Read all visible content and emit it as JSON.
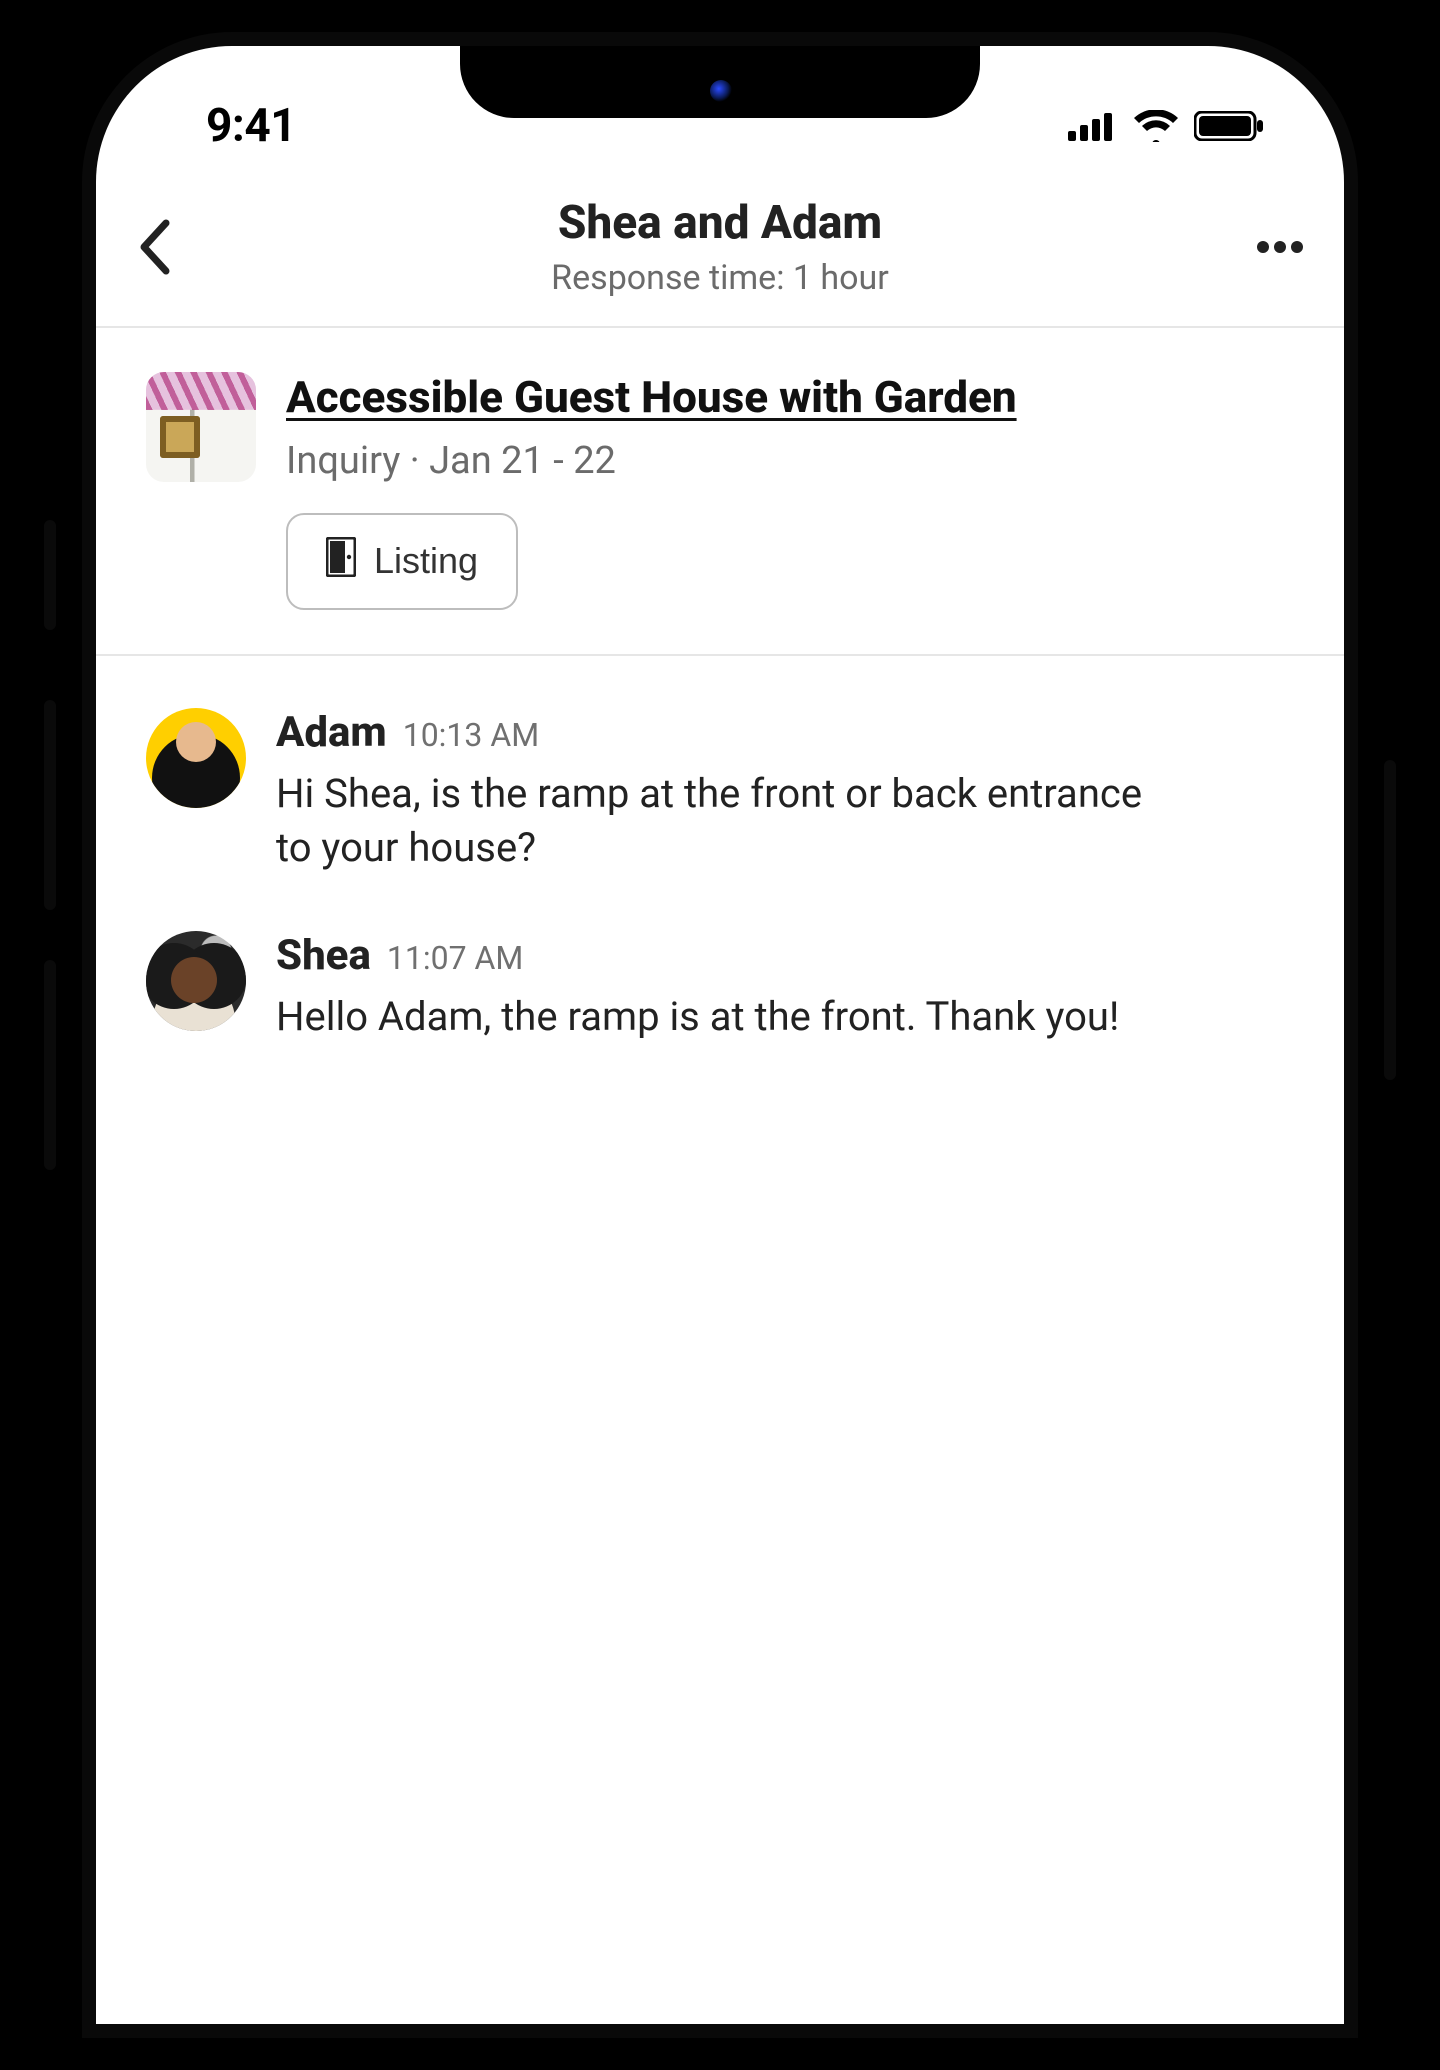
{
  "status": {
    "time": "9:41"
  },
  "header": {
    "title": "Shea and Adam",
    "subtitle": "Response time: 1 hour"
  },
  "listing": {
    "title": "Accessible Guest House with Garden",
    "meta": "Inquiry · Jan 21 - 22",
    "button_label": "Listing"
  },
  "messages": [
    {
      "sender": "Adam",
      "time": "10:13 AM",
      "text": "Hi Shea, is the ramp at the front or back entrance to your house?",
      "avatar": "adam"
    },
    {
      "sender": "Shea",
      "time": "11:07 AM",
      "text": "Hello Adam, the ramp is at the front. Thank you!",
      "avatar": "shea"
    }
  ]
}
